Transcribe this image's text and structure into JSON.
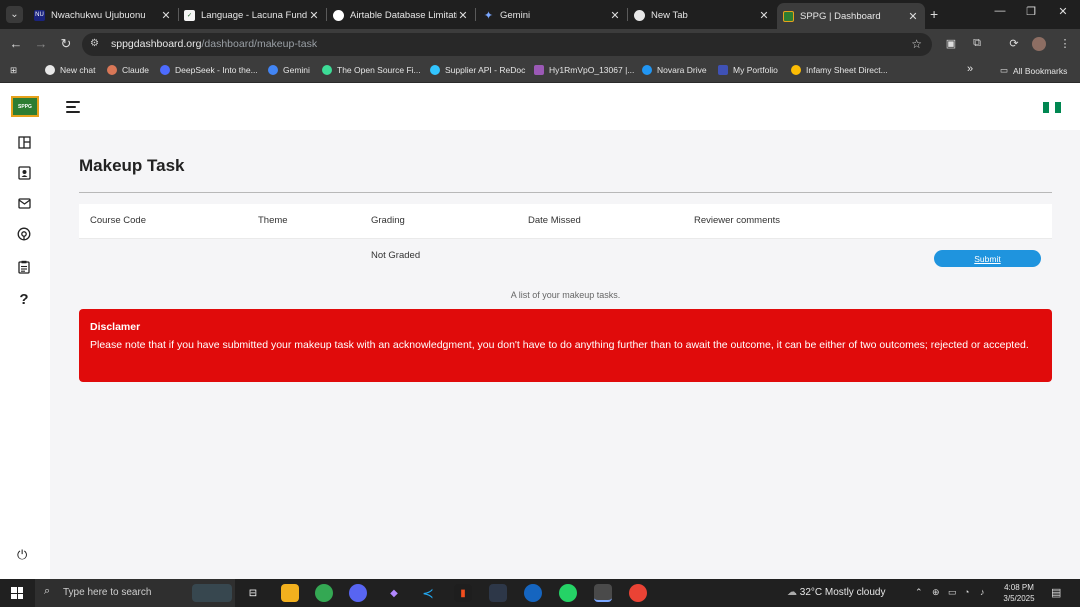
{
  "browser": {
    "tabs": [
      {
        "title": "Nwachukwu Ujubuonu",
        "favicon_color": "#1a237e",
        "favicon_text": "NU"
      },
      {
        "title": "Language - Lacuna Fund",
        "favicon_color": "#f5f5f5",
        "favicon_text": ""
      },
      {
        "title": "Airtable Database Limitati",
        "favicon_color": "#ffffff",
        "favicon_text": ""
      },
      {
        "title": "Gemini",
        "favicon_color": "#4285f4",
        "favicon_text": "✦"
      },
      {
        "title": "New Tab",
        "favicon_color": "#e8e8e8",
        "favicon_text": ""
      },
      {
        "title": "SPPG | Dashboard",
        "favicon_color": "#2e7d32",
        "favicon_text": ""
      }
    ],
    "url_host": "sppgdashboard.org",
    "url_path": "/dashboard/makeup-task",
    "bookmarks": [
      {
        "label": "New chat",
        "color": "#e8e8e8"
      },
      {
        "label": "Claude",
        "color": "#d97757"
      },
      {
        "label": "DeepSeek - Into the...",
        "color": "#4d6bfe"
      },
      {
        "label": "Gemini",
        "color": "#4285f4"
      },
      {
        "label": "The Open Source Fi...",
        "color": "#3ddc97"
      },
      {
        "label": "Supplier API - ReDoc",
        "color": "#32c5ff"
      },
      {
        "label": "Hy1RmVpO_13067 |...",
        "color": "#9b59b6"
      },
      {
        "label": "Novara Drive",
        "color": "#2196f3"
      },
      {
        "label": "My Portfolio",
        "color": "#3f51b5"
      },
      {
        "label": "Infamy Sheet Direct...",
        "color": "#fbbc04"
      }
    ],
    "all_bookmarks": "All Bookmarks",
    "overflow": "»"
  },
  "app": {
    "logo_text": "SPPG",
    "page_title": "Makeup Task",
    "table": {
      "headers": [
        "Course Code",
        "Theme",
        "Grading",
        "Date Missed",
        "Reviewer comments"
      ],
      "rows": [
        {
          "course_code": "",
          "theme": "",
          "grading": "Not Graded",
          "date_missed": "",
          "reviewer_comments": "",
          "action": "Submit"
        }
      ],
      "caption": "A list of your makeup tasks."
    },
    "disclaimer": {
      "title": "Disclamer",
      "body": "Please note that if you have submitted your makeup task with an acknowledgment, you don't have to do anything further than to await the outcome, it can be either of two outcomes; rejected or accepted."
    },
    "colors": {
      "accent": "#1f94de",
      "disclaimer_bg": "#e00b0b",
      "flag": [
        "#008751",
        "#ffffff",
        "#008751"
      ]
    }
  },
  "taskbar": {
    "search_placeholder": "Type here to search",
    "weather": "32°C  Mostly cloudy",
    "time": "4:08 PM",
    "date": "3/5/2025",
    "notification_count": "3"
  }
}
